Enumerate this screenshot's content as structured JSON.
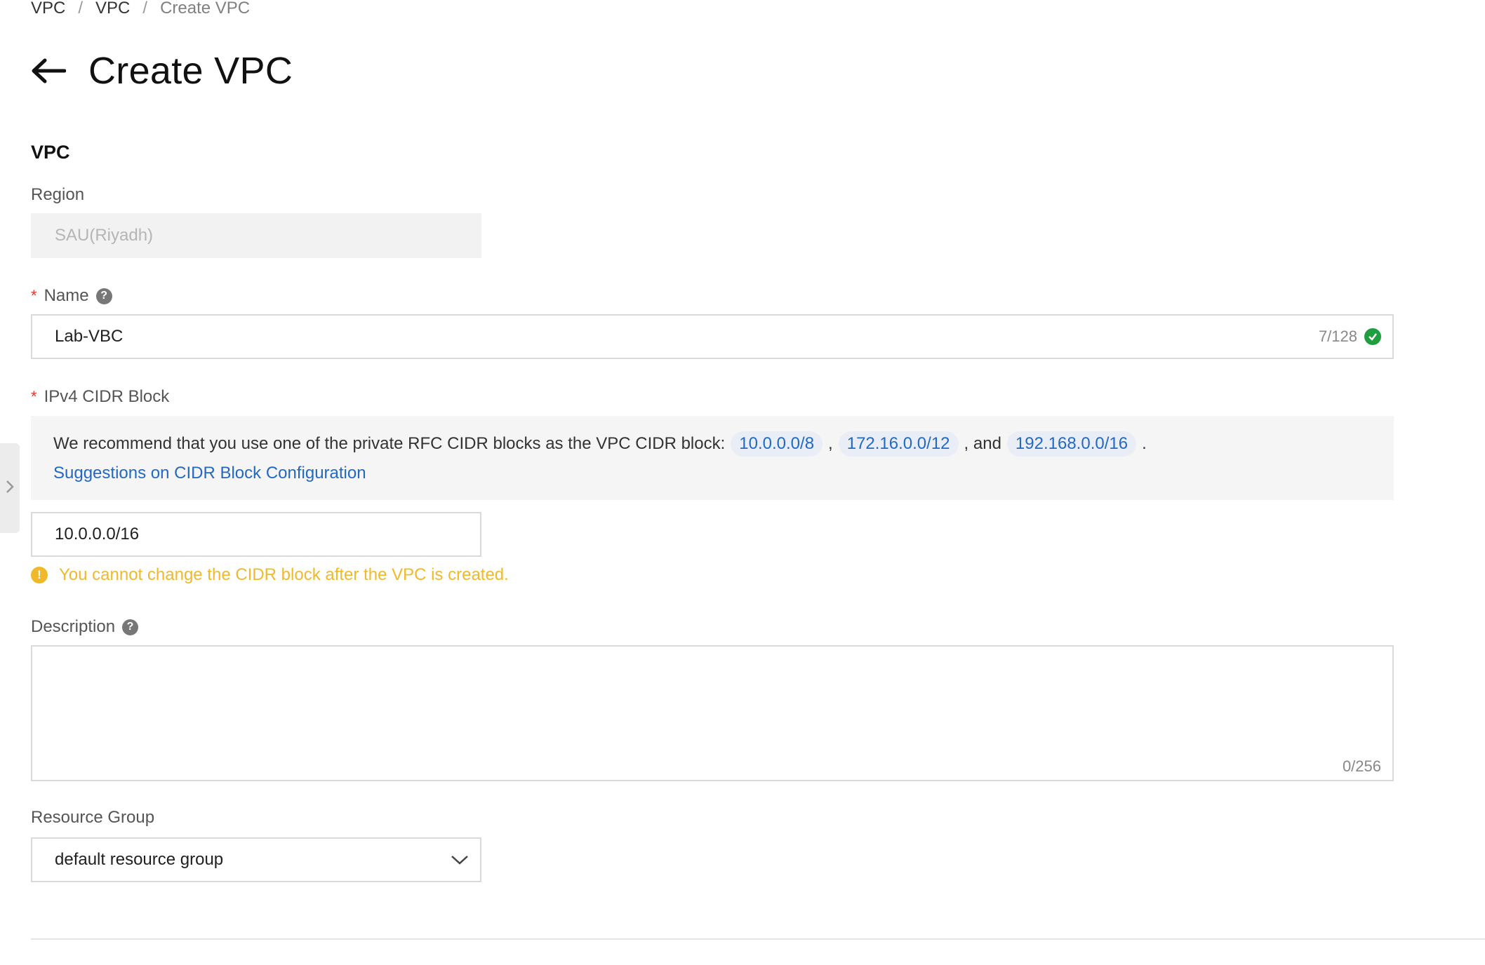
{
  "breadcrumb": {
    "items": [
      "VPC",
      "VPC",
      "Create VPC"
    ],
    "separator": "/"
  },
  "header": {
    "title": "Create VPC"
  },
  "section": {
    "title": "VPC"
  },
  "region": {
    "label": "Region",
    "value": "SAU(Riyadh)"
  },
  "name": {
    "label": "Name",
    "required_mark": "*",
    "value": "Lab-VBC",
    "counter": "7/128",
    "status": "valid"
  },
  "cidr": {
    "label": "IPv4 CIDR Block",
    "required_mark": "*",
    "recommend_text": "We recommend that you use one of the private RFC CIDR blocks as the VPC CIDR block:",
    "chips": [
      "10.0.0.0/8",
      "172.16.0.0/12",
      "192.168.0.0/16"
    ],
    "comma": ",",
    "and_text": ", and",
    "period": ".",
    "suggestion_link": "Suggestions on CIDR Block Configuration",
    "value": "10.0.0.0/16",
    "warning": "You cannot change the CIDR block after the VPC is created."
  },
  "description": {
    "label": "Description",
    "value": "",
    "counter": "0/256"
  },
  "resource_group": {
    "label": "Resource Group",
    "value": "default resource group"
  },
  "colors": {
    "accent": "#2369c3",
    "warning": "#f0b92a",
    "success": "#1e9e3f",
    "required": "#e5322d"
  },
  "icons": {
    "back": "arrow-left-icon",
    "help": "question-circle-icon",
    "valid": "check-circle-icon",
    "warning": "exclamation-circle-icon",
    "dropdown": "chevron-down-icon",
    "expand": "chevron-right-icon"
  }
}
